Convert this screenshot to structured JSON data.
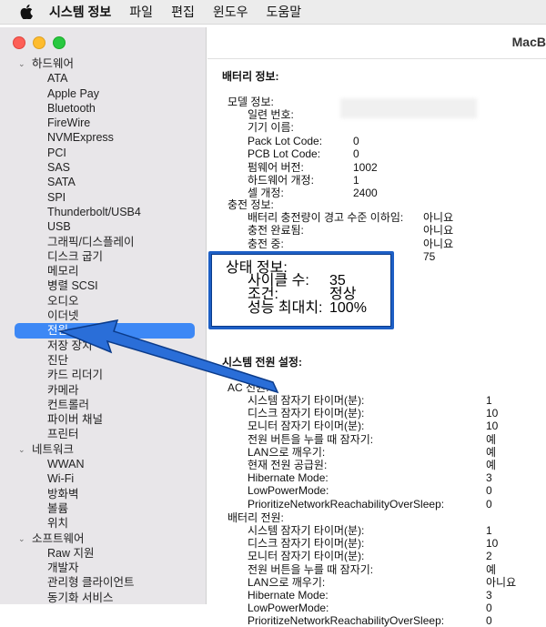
{
  "menubar": {
    "app": "시스템 정보",
    "items": [
      "파일",
      "편집",
      "윈도우",
      "도움말"
    ]
  },
  "window": {
    "title": "MacB"
  },
  "sidebar": {
    "groups": [
      {
        "label": "하드웨어",
        "items": [
          "ATA",
          "Apple Pay",
          "Bluetooth",
          "FireWire",
          "NVMExpress",
          "PCI",
          "SAS",
          "SATA",
          "SPI",
          "Thunderbolt/USB4",
          "USB",
          "그래픽/디스플레이",
          "디스크 굽기",
          "메모리",
          "병렬 SCSI",
          "오디오",
          "이더넷",
          "전원",
          "저장 장치",
          "진단",
          "카드 리더기",
          "카메라",
          "컨트롤러",
          "파이버 채널",
          "프린터"
        ]
      },
      {
        "label": "네트워크",
        "items": [
          "WWAN",
          "Wi-Fi",
          "방화벽",
          "볼륨",
          "위치"
        ]
      },
      {
        "label": "소프트웨어",
        "items": [
          "Raw 지원",
          "개발자",
          "관리형 클라이언트",
          "동기화 서비스"
        ]
      }
    ],
    "selected": "전원"
  },
  "content": {
    "battery_title": "배터리 정보:",
    "model_label": "모델 정보:",
    "model": [
      {
        "k": "일련 번호:",
        "v": ""
      },
      {
        "k": "기기 이름:",
        "v": ""
      },
      {
        "k": "Pack Lot Code:",
        "v": "0"
      },
      {
        "k": "PCB Lot Code:",
        "v": "0"
      },
      {
        "k": "펌웨어 버전:",
        "v": "1002"
      },
      {
        "k": "하드웨어 개정:",
        "v": "1"
      },
      {
        "k": "셀 개정:",
        "v": "2400"
      }
    ],
    "charge_label": "충전 정보:",
    "charge": [
      {
        "k": "배터리 충전량이 경고 수준 이하임:",
        "v": "아니요"
      },
      {
        "k": "충전 완료됨:",
        "v": "아니요"
      },
      {
        "k": "충전 중:",
        "v": "아니요"
      },
      {
        "k": "",
        "v": "75"
      }
    ],
    "status_label": "상태 정보:",
    "status": [
      {
        "k": "사이클 수:",
        "v": "35"
      },
      {
        "k": "조건:",
        "v": "정상"
      },
      {
        "k": "성능 최대치:",
        "v": "100%"
      }
    ],
    "power_title": "시스템 전원 설정:",
    "ac_label": "AC 전원:",
    "ac": [
      {
        "k": "시스템 잠자기 타이머(분):",
        "v": "1"
      },
      {
        "k": "디스크 잠자기 타이머(분):",
        "v": "10"
      },
      {
        "k": "모니터 잠자기 타이머(분):",
        "v": "10"
      },
      {
        "k": "전원 버튼을 누를 때 잠자기:",
        "v": "예"
      },
      {
        "k": "LAN으로 깨우기:",
        "v": "예"
      },
      {
        "k": "현재 전원 공급원:",
        "v": "예"
      },
      {
        "k": "Hibernate Mode:",
        "v": "3"
      },
      {
        "k": "LowPowerMode:",
        "v": "0"
      },
      {
        "k": "PrioritizeNetworkReachabilityOverSleep:",
        "v": "0"
      }
    ],
    "bat_label": "배터리 전원:",
    "bat": [
      {
        "k": "시스템 잠자기 타이머(분):",
        "v": "1"
      },
      {
        "k": "디스크 잠자기 타이머(분):",
        "v": "10"
      },
      {
        "k": "모니터 잠자기 타이머(분):",
        "v": "2"
      },
      {
        "k": "전원 버튼을 누를 때 잠자기:",
        "v": "예"
      },
      {
        "k": "LAN으로 깨우기:",
        "v": "아니요"
      },
      {
        "k": "Hibernate Mode:",
        "v": "3"
      },
      {
        "k": "LowPowerMode:",
        "v": "0"
      },
      {
        "k": "PrioritizeNetworkReachabilityOverSleep:",
        "v": "0"
      }
    ]
  },
  "colors": {
    "selection": "#3d88f5",
    "annotation": "#1d5fc5"
  }
}
